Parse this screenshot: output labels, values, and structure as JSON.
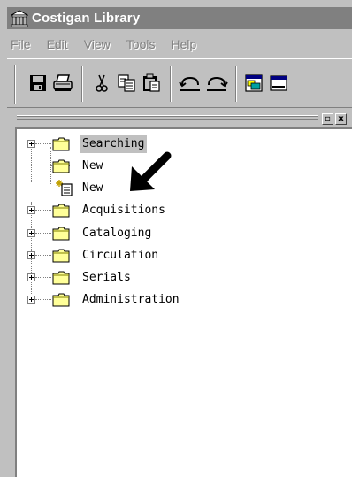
{
  "window": {
    "title": "Costigan Library"
  },
  "menu": [
    {
      "label": "File"
    },
    {
      "label": "Edit"
    },
    {
      "label": "View"
    },
    {
      "label": "Tools"
    },
    {
      "label": "Help"
    }
  ],
  "toolbar": {
    "buttons": [
      {
        "icon": "save-icon"
      },
      {
        "icon": "print-icon"
      },
      {
        "icon": "cut-icon"
      },
      {
        "icon": "copy-icon"
      },
      {
        "icon": "paste-icon"
      },
      {
        "icon": "undo-icon"
      },
      {
        "icon": "redo-icon"
      },
      {
        "icon": "window-icon"
      },
      {
        "icon": "form-icon"
      }
    ]
  },
  "panel": {
    "close_label": "x",
    "restore_label": "▫"
  },
  "tree": {
    "nodes": [
      {
        "label": "Searching",
        "selected": true,
        "expandable": true,
        "icon": "folder-icon"
      },
      {
        "label": "New",
        "expandable": false,
        "icon": "folder-icon"
      },
      {
        "label": "New",
        "expandable": false,
        "icon": "new-document-icon"
      },
      {
        "label": "Acquisitions",
        "expandable": true,
        "icon": "folder-icon"
      },
      {
        "label": "Cataloging",
        "expandable": true,
        "icon": "folder-icon"
      },
      {
        "label": "Circulation",
        "expandable": true,
        "icon": "folder-icon"
      },
      {
        "label": "Serials",
        "expandable": true,
        "icon": "folder-icon"
      },
      {
        "label": "Administration",
        "expandable": true,
        "icon": "folder-icon"
      }
    ]
  },
  "colors": {
    "titlebar": "#808080",
    "chrome": "#c0c0c0",
    "folder": "#ffff99",
    "arrow": "#000000"
  }
}
